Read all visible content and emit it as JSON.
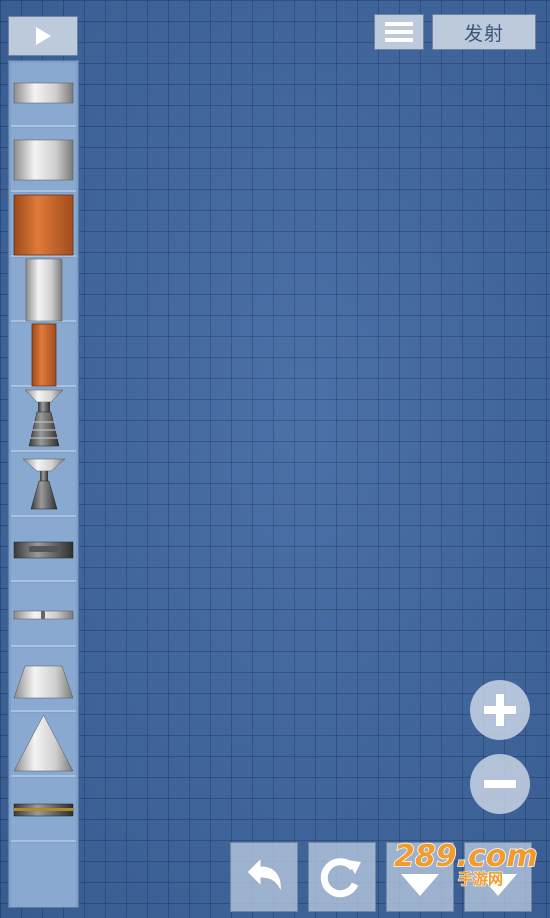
{
  "toolbar": {
    "play_icon": "play-icon",
    "menu_icon": "hamburger-menu-icon",
    "launch_label": "发射"
  },
  "parts": [
    {
      "name": "fuel-tank-small",
      "icon": "fuel-tank-icon"
    },
    {
      "name": "fuel-tank-medium",
      "icon": "fuel-tank-icon"
    },
    {
      "name": "fuel-tank-orange-large",
      "icon": "fuel-tank-icon"
    },
    {
      "name": "fuel-tank-tall",
      "icon": "fuel-tank-icon"
    },
    {
      "name": "fuel-tank-orange-thin",
      "icon": "fuel-tank-icon"
    },
    {
      "name": "engine-large",
      "icon": "engine-icon"
    },
    {
      "name": "engine-small",
      "icon": "engine-icon"
    },
    {
      "name": "separator",
      "icon": "separator-icon"
    },
    {
      "name": "decoupler-thin",
      "icon": "decoupler-icon"
    },
    {
      "name": "adapter-frustum",
      "icon": "adapter-icon"
    },
    {
      "name": "nose-cone",
      "icon": "nose-cone-icon"
    },
    {
      "name": "heat-shield",
      "icon": "heat-shield-icon"
    }
  ],
  "zoom": {
    "in_icon": "plus-icon",
    "out_icon": "minus-icon"
  },
  "bottom_bar": {
    "undo_icon": "undo-icon",
    "rotate_icon": "rotate-icon",
    "down_icon": "chevron-down-icon",
    "delete_icon": "chevron-down-icon"
  },
  "watermark": {
    "brand": "289.com",
    "subtitle": "手游网"
  },
  "colors": {
    "grid_bg": "#3f68a3",
    "panel": "#7fa0c9",
    "button": "#bccadb",
    "orange_tank": "#cf6a2c",
    "watermark_orange": "#f29b2e"
  }
}
